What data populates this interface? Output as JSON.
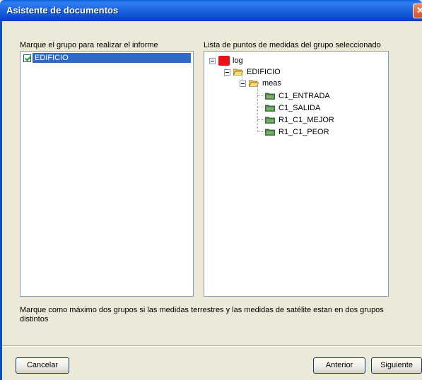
{
  "window": {
    "title": "Asistente de documentos",
    "close_glyph": "✕"
  },
  "left_panel": {
    "label": "Marque el grupo para realizar el informe",
    "items": [
      {
        "label": "EDIFICIO",
        "checked": true
      }
    ]
  },
  "right_panel": {
    "label": "Lista de puntos de medidas del grupo seleccionado",
    "tree": {
      "root": "log",
      "group": "EDIFICIO",
      "folder": "meas",
      "points": [
        "C1_ENTRADA",
        "C1_SALIDA",
        "R1_C1_MEJOR",
        "R1_C1_PEOR"
      ]
    }
  },
  "note": "Marque como máximo dos grupos si las medidas terrestres y las medidas de satélite estan en dos grupos distintos",
  "buttons": {
    "cancel": "Cancelar",
    "previous": "Anterior",
    "next": "Siguiente"
  },
  "colors": {
    "titlebar": "#0b4fd2",
    "selection": "#316ac5",
    "log_icon": "#e8131a",
    "dialog_bg": "#ece9d8"
  }
}
